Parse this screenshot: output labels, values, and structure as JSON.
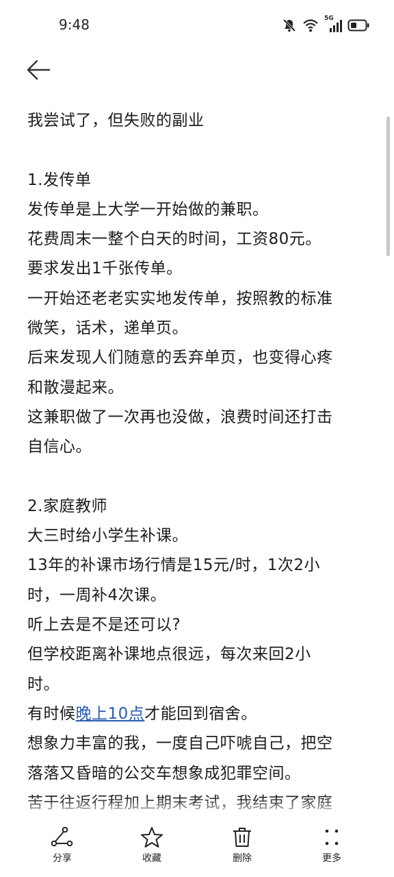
{
  "status_bar": {
    "time": "9:48",
    "icons": [
      "bell-muted-icon",
      "wifi-icon",
      "cell-signal-5g-icon",
      "battery-icon"
    ],
    "network_label": "5G"
  },
  "nav": {
    "back_icon": "back-arrow-icon"
  },
  "article": {
    "lines": [
      {
        "text": "我尝试了，但失败的副业"
      },
      {
        "text": ""
      },
      {
        "text": "1.发传单"
      },
      {
        "text": "发传单是上大学一开始做的兼职。"
      },
      {
        "text": "花费周末一整个白天的时间，工资80元。"
      },
      {
        "text": "要求发出1千张传单。"
      },
      {
        "text": "一开始还老老实实地发传单，按照教的标准"
      },
      {
        "text": "微笑，话术，递单页。"
      },
      {
        "text": "后来发现人们随意的丢弃单页，也变得心疼"
      },
      {
        "text": "和散漫起来。"
      },
      {
        "text": "这兼职做了一次再也没做，浪费时间还打击"
      },
      {
        "text": "自信心。"
      },
      {
        "text": ""
      },
      {
        "text": "2.家庭教师"
      },
      {
        "text": "大三时给小学生补课。"
      },
      {
        "text": "13年的补课市场行情是15元/时，1次2小"
      },
      {
        "text": "时，一周补4次课。"
      },
      {
        "text": "听上去是不是还可以?"
      },
      {
        "text": "但学校距离补课地点很远，每次来回2小"
      },
      {
        "text": "时。"
      },
      {
        "text": "想象力丰富的我，一度自己吓唬自己，把空"
      },
      {
        "text": "落落又昏暗的公交车想象成犯罪空间。"
      },
      {
        "text": "苦于往返行程加上期末考试，我结束了家庭"
      }
    ],
    "link_line": {
      "before": "有时候",
      "link": "晚上10点",
      "after": "才能回到宿舍。"
    }
  },
  "bottom_bar": {
    "share": {
      "label": "分享",
      "icon": "share-icon"
    },
    "favorite": {
      "label": "收藏",
      "icon": "star-icon"
    },
    "delete": {
      "label": "删除",
      "icon": "trash-icon"
    },
    "more": {
      "label": "更多",
      "icon": "more-dots-icon"
    }
  },
  "colors": {
    "link": "#2a5db0",
    "text": "#1c1c1c",
    "background": "#ffffff"
  }
}
